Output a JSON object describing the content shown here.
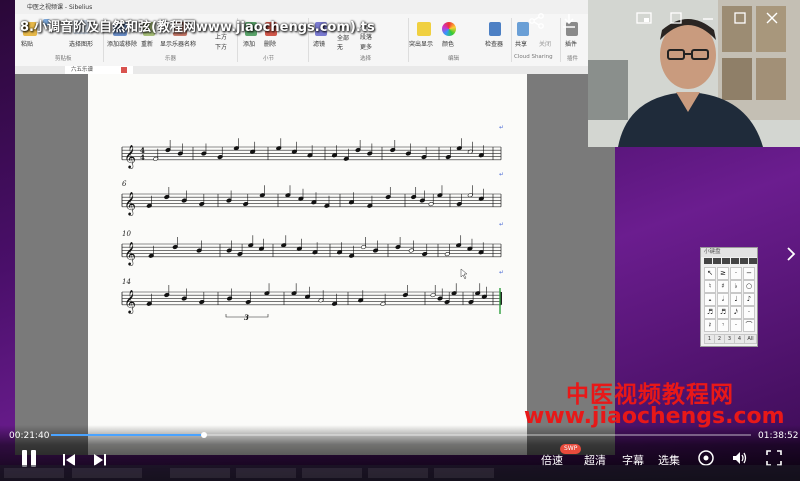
{
  "video": {
    "title": "8.小调音阶及自然和弦(教程网www.jiaochengs.com).ts"
  },
  "app": {
    "window_title": "中医之视频课 - Sibelius",
    "document_tab": "六五乐谱"
  },
  "ribbon": {
    "buttons": [
      {
        "id": "paste",
        "label": "粘贴"
      },
      {
        "id": "copy",
        "label": "复制"
      },
      {
        "id": "select",
        "label": "选择图形"
      },
      {
        "id": "add-staves",
        "label": "添加或移除"
      },
      {
        "id": "reset",
        "label": "重新"
      },
      {
        "id": "show-instrument",
        "label": "显示乐器名称"
      },
      {
        "id": "above",
        "label": "上方"
      },
      {
        "id": "below",
        "label": "下方"
      },
      {
        "id": "add",
        "label": "添加"
      },
      {
        "id": "delete",
        "label": "删除"
      },
      {
        "id": "filter",
        "label": "滤镜"
      },
      {
        "id": "all",
        "label": "全部"
      },
      {
        "id": "none",
        "label": "无"
      },
      {
        "id": "more",
        "label": "更多"
      },
      {
        "id": "bar",
        "label": "小节"
      },
      {
        "id": "passage",
        "label": "段落"
      },
      {
        "id": "highlight",
        "label": "突出显示"
      },
      {
        "id": "color",
        "label": "颜色"
      },
      {
        "id": "inspector",
        "label": "检查器"
      },
      {
        "id": "share",
        "label": "共享"
      },
      {
        "id": "close",
        "label": "关闭"
      },
      {
        "id": "plugins",
        "label": "插件"
      }
    ],
    "groups": [
      "剪贴板",
      "乐器",
      "小节",
      "选择",
      "编辑",
      "Cloud Sharing",
      "插件"
    ]
  },
  "score": {
    "measure_numbers": [
      "6",
      "10",
      "14"
    ],
    "tuplet_label": "3"
  },
  "keypad": {
    "title": "小键盘",
    "rows": [
      [
        "↖",
        "≥",
        "·",
        "−"
      ],
      [
        "♮",
        "♯",
        "♭",
        "○"
      ],
      [
        "𝅝",
        "𝅗𝅥",
        "♩",
        "♪"
      ],
      [
        "♬",
        "♬",
        "𝅘𝅥𝅯",
        "·"
      ],
      [
        "𝄽",
        "𝄾",
        "·",
        "⌒"
      ]
    ],
    "tabs": [
      "1",
      "2",
      "3",
      "4",
      "All"
    ]
  },
  "watermark": {
    "line1": "中医视频教程网",
    "line2": "www.jiaochengs.com"
  },
  "player": {
    "current_time": "00:21:40",
    "total_time": "01:38:52",
    "progress": 0.219,
    "speed_label": "倍速",
    "speed_badge": "SWP",
    "quality_label": "超清",
    "subtitle_label": "字幕",
    "episodes_label": "选集"
  },
  "colors": {
    "progress_fill": "#4aa3ff",
    "watermark": "#e81818",
    "badge": "#e94b3c"
  }
}
